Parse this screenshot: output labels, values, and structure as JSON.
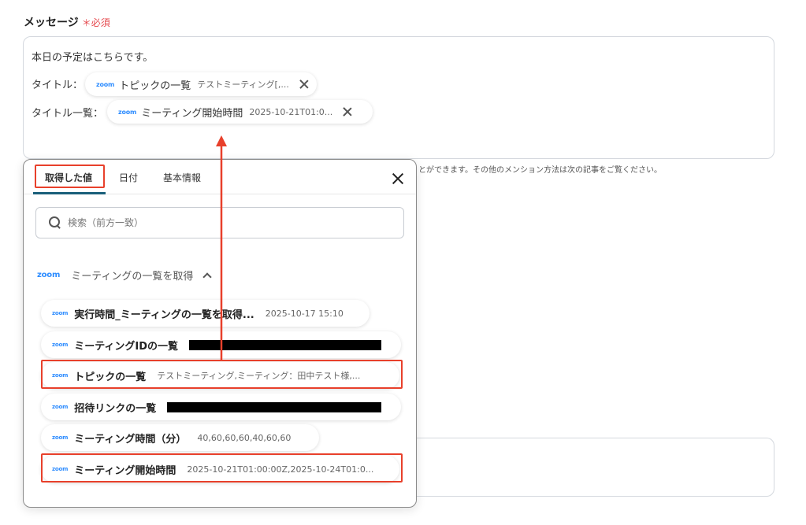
{
  "field": {
    "label": "メッセージ",
    "required": "必須"
  },
  "message": {
    "line1": "本日の予定はこちらです。",
    "row1_label": "タイトル：",
    "row1_pill": {
      "label": "トピックの一覧",
      "value": "テストミーティング[,..."
    },
    "row2_label": "タイトル一覧：",
    "row2_pill": {
      "label": "ミーティング開始時間",
      "value": "2025-10-21T01:0..."
    }
  },
  "hint": "とができます。その他のメンション方法は次の記事をご覧ください。",
  "zoom_logo": "zoom",
  "panel": {
    "tabs": [
      "取得した値",
      "日付",
      "基本情報"
    ],
    "search_placeholder": "検索（前方一致）",
    "section_title": "ミーティングの一覧を取得",
    "items": [
      {
        "label": "実行時間_ミーティングの一覧を取得...",
        "value": "2025-10-17 15:10"
      },
      {
        "label": "ミーティングIDの一覧",
        "value": ""
      },
      {
        "label": "トピックの一覧",
        "value": "テストミーティング,ミーティング：田中テスト様,..."
      },
      {
        "label": "招待リンクの一覧",
        "value": ""
      },
      {
        "label": "ミーティング時間（分）",
        "value": "40,60,60,60,40,60,60"
      },
      {
        "label": "ミーティング開始時間",
        "value": "2025-10-21T01:00:00Z,2025-10-24T01:0..."
      }
    ]
  },
  "colors": {
    "highlight": "#e8402b",
    "zoom": "#2d8cff",
    "tab_underline": "#1a5f7a",
    "required": "#e5484d"
  }
}
